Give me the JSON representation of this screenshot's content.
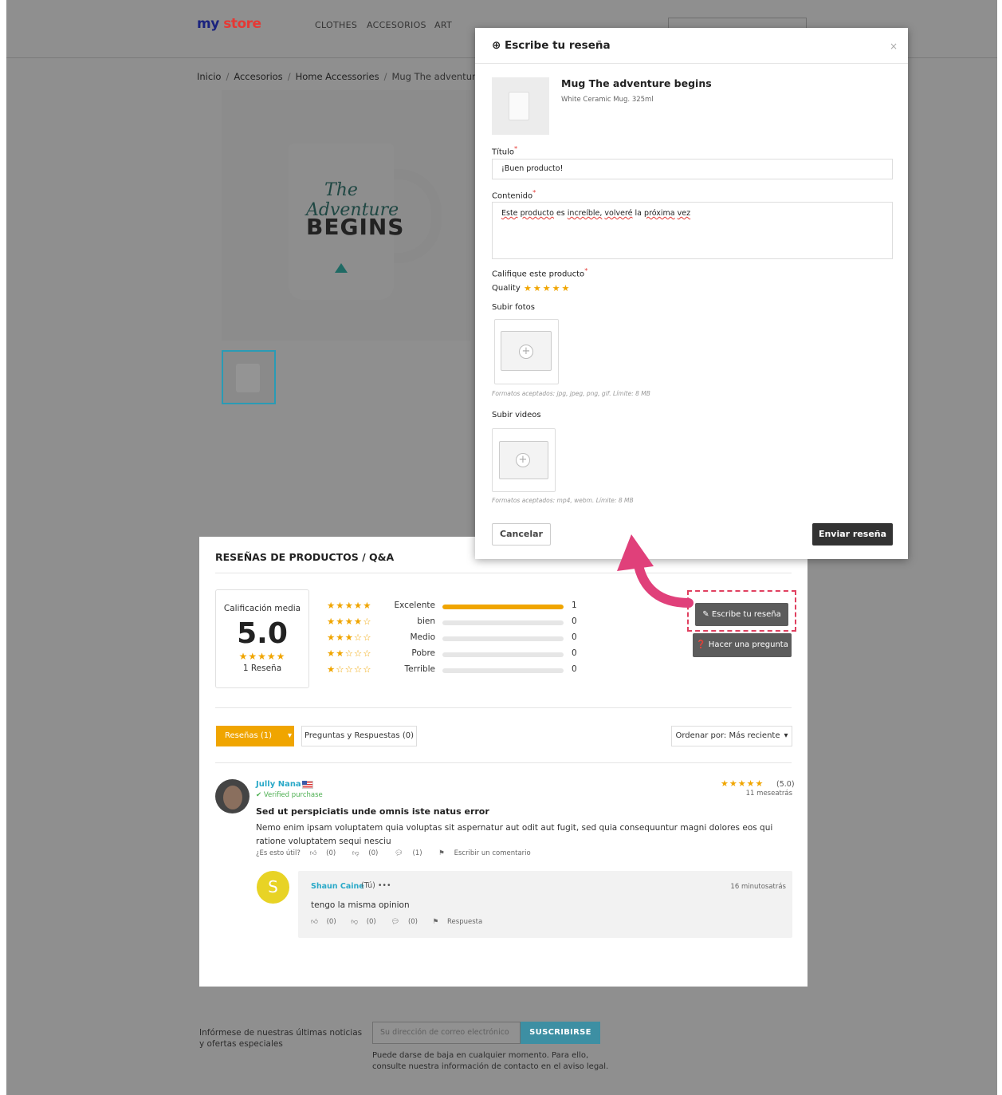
{
  "header": {
    "logo_part1": "my",
    "logo_part2": "store",
    "nav": [
      "CLOTHES",
      "ACCESORIOS",
      "ART"
    ]
  },
  "breadcrumb": [
    "Inicio",
    "Accesorios",
    "Home Accessories",
    "Mug The adventure be"
  ],
  "product_image": {
    "mug_text_1": "The Adventure",
    "mug_text_2": "BEGINS"
  },
  "reviews": {
    "section_title": "RESEÑAS DE PRODUCTOS / Q&A",
    "average_label": "Calificación media",
    "average_value": "5.0",
    "average_stars": "★★★★★",
    "review_count": "1 Reseña",
    "breakdown": [
      {
        "stars": "★★★★★",
        "label": "Excelente",
        "count": "1",
        "fraction": 1.0
      },
      {
        "stars": "★★★★☆",
        "label": "bien",
        "count": "0",
        "fraction": 0
      },
      {
        "stars": "★★★☆☆",
        "label": "Medio",
        "count": "0",
        "fraction": 0
      },
      {
        "stars": "★★☆☆☆",
        "label": "Pobre",
        "count": "0",
        "fraction": 0
      },
      {
        "stars": "★☆☆☆☆",
        "label": "Terrible",
        "count": "0",
        "fraction": 0
      }
    ],
    "write_review_label": "Escribe tu reseña",
    "ask_question_label": "Hacer una pregunta",
    "tab_reviews": "Reseñas (1)",
    "tab_qa": "Preguntas y Respuestas (0)",
    "sort_label": "Ordenar por: Más reciente",
    "item": {
      "author": "Jully Nana",
      "verified": "✔ Verified purchase",
      "stars": "★★★★★",
      "score": "(5.0)",
      "time_ago": "11 meseatrás",
      "title": "Sed ut perspiciatis unde omnis iste natus error",
      "body": "Nemo enim ipsam voluptatem quia voluptas sit aspernatur aut odit aut fugit, sed quia consequuntur magni dolores eos qui ratione voluptatem sequi nesciu",
      "helpful_label": "¿Es esto útil?",
      "likes": "(0)",
      "dislikes": "(0)",
      "comments": "(1)",
      "write_comment": "Escribir un comentario"
    },
    "reply": {
      "avatar_letter": "S",
      "author": "Shaun Caine",
      "you_label": "(Tú)",
      "more": "•••",
      "time_ago": "16 minutosatrás",
      "text": "tengo la misma opinion",
      "likes": "(0)",
      "dislikes": "(0)",
      "comments": "(0)",
      "reply_label": "Respuesta"
    }
  },
  "footer": {
    "newsletter_text": "Infórmese de nuestras últimas noticias y ofertas especiales",
    "email_placeholder": "Su dirección de correo electrónico",
    "subscribe_label": "SUSCRIBIRSE",
    "note": "Puede darse de baja en cualquier momento. Para ello, consulte nuestra información de contacto en el aviso legal."
  },
  "modal": {
    "title": "Escribe tu reseña",
    "close": "×",
    "product_name": "Mug The adventure begins",
    "product_desc": "White Ceramic Mug. 325ml",
    "title_label": "Título",
    "title_value": "¡Buen producto!",
    "content_label": "Contenido",
    "content_words": [
      "Este",
      "producto",
      "es",
      "increíble,",
      "volveré",
      "la",
      "próxima",
      "vez"
    ],
    "rate_label": "Califique este producto",
    "quality_label": "Quality",
    "quality_stars": "★★★★★",
    "upload_photos_label": "Subir fotos",
    "photos_hint": "Formatos aceptados: jpg, jpeg, png, gif. Límite: 8 MB",
    "upload_videos_label": "Subir videos",
    "videos_hint": "Formatos aceptados: mp4, webm. Límite: 8 MB",
    "cancel_label": "Cancelar",
    "submit_label": "Enviar reseña",
    "required_mark": "*"
  },
  "colors": {
    "accent": "#f0a500",
    "link": "#2aa9c8",
    "subscribe": "#3d8fa3",
    "highlight": "#e04060"
  }
}
